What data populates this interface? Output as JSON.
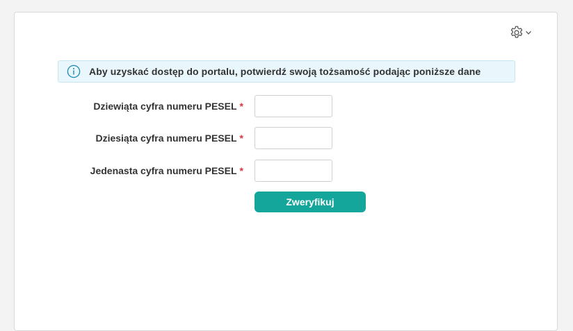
{
  "header": {
    "settings_icon": "gear-icon",
    "dropdown_icon": "chevron-down-icon"
  },
  "info": {
    "icon": "info-icon",
    "text": "Aby uzyskać dostęp do portalu, potwierdź swoją tożsamość podając poniższe dane",
    "accent_color": "#1a8ab5"
  },
  "form": {
    "required_mark": "*",
    "fields": [
      {
        "label": "Dziewiąta cyfra numeru PESEL",
        "value": "",
        "placeholder": ""
      },
      {
        "label": "Dziesiąta cyfra numeru PESEL",
        "value": "",
        "placeholder": ""
      },
      {
        "label": "Jedenasta cyfra numeru PESEL",
        "value": "",
        "placeholder": ""
      }
    ],
    "submit_label": "Zweryfikuj",
    "submit_color": "#14a69a"
  }
}
